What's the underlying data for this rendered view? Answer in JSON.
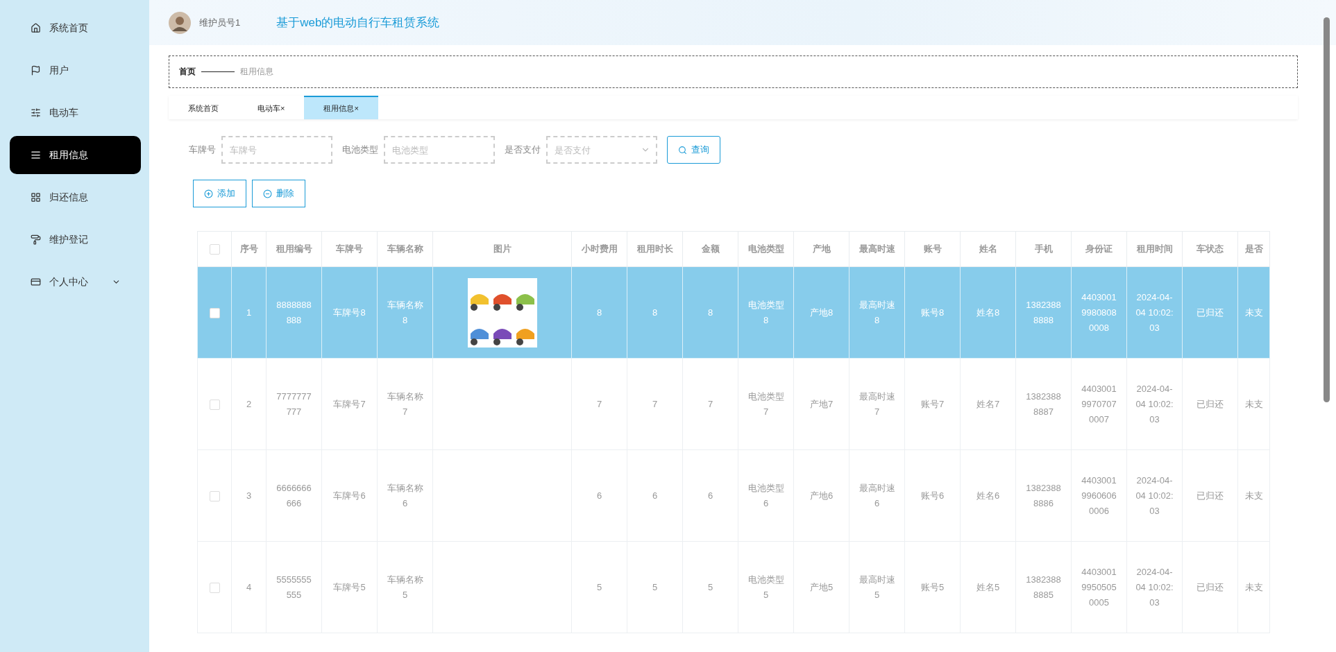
{
  "sidebar": {
    "items": [
      {
        "label": "系统首页",
        "selected": false
      },
      {
        "label": "用户",
        "selected": false
      },
      {
        "label": "电动车",
        "selected": false
      },
      {
        "label": "租用信息",
        "selected": true
      },
      {
        "label": "归还信息",
        "selected": false
      },
      {
        "label": "维护登记",
        "selected": false
      },
      {
        "label": "个人中心",
        "selected": false,
        "expanded": false
      }
    ]
  },
  "header": {
    "user": "维护员号1",
    "title": "基于web的电动自行车租赁系统"
  },
  "breadcrumb": {
    "home": "首页",
    "current": "租用信息"
  },
  "tabs": [
    {
      "label": "系统首页",
      "selected": false
    },
    {
      "label": "电动车",
      "close": "×",
      "selected": false
    },
    {
      "label": "租用信息",
      "close": "×",
      "selected": true
    }
  ],
  "filters": [
    {
      "kind": "input",
      "label": "车牌号",
      "placeholder": "车牌号"
    },
    {
      "kind": "input",
      "label": "电池类型",
      "placeholder": "电池类型"
    },
    {
      "kind": "select",
      "label": "是否支付",
      "placeholder": "是否支付"
    }
  ],
  "search_button": "查询",
  "actions": [
    {
      "kind": "add",
      "label": "添加"
    },
    {
      "kind": "delete",
      "label": "删除"
    }
  ],
  "table": {
    "all_checked": false,
    "columns": [
      "序号",
      "租用编号",
      "车牌号",
      "车辆名称",
      "图片",
      "小时费用",
      "租用时长",
      "金额",
      "电池类型",
      "产地",
      "最高时速",
      "账号",
      "姓名",
      "手机",
      "身份证",
      "租用时间",
      "车状态",
      "是否"
    ],
    "rows": [
      {
        "selected": true,
        "checked": false,
        "cells": [
          "1",
          "8888888888",
          "车牌号8",
          "车辆名称8",
          "",
          "8",
          "8",
          "8",
          "电池类型8",
          "产地8",
          "最高时速8",
          "账号8",
          "姓名8",
          "13823888888",
          "440300199808080008",
          "2024-04-04 10:02:03",
          "已归还",
          "未支"
        ]
      },
      {
        "selected": false,
        "checked": false,
        "cells": [
          "2",
          "7777777777",
          "车牌号7",
          "车辆名称7",
          "",
          "7",
          "7",
          "7",
          "电池类型7",
          "产地7",
          "最高时速7",
          "账号7",
          "姓名7",
          "13823888887",
          "440300199707070007",
          "2024-04-04 10:02:03",
          "已归还",
          "未支"
        ]
      },
      {
        "selected": false,
        "checked": false,
        "cells": [
          "3",
          "6666666666",
          "车牌号6",
          "车辆名称6",
          "",
          "6",
          "6",
          "6",
          "电池类型6",
          "产地6",
          "最高时速6",
          "账号6",
          "姓名6",
          "13823888886",
          "440300199606060006",
          "2024-04-04 10:02:03",
          "已归还",
          "未支"
        ]
      },
      {
        "selected": false,
        "checked": false,
        "cells": [
          "4",
          "5555555555",
          "车牌号5",
          "车辆名称5",
          "",
          "5",
          "5",
          "5",
          "电池类型5",
          "产地5",
          "最高时速5",
          "账号5",
          "姓名5",
          "13823888885",
          "440300199505050005",
          "2024-04-04 10:02:03",
          "已归还",
          "未支"
        ]
      }
    ]
  }
}
